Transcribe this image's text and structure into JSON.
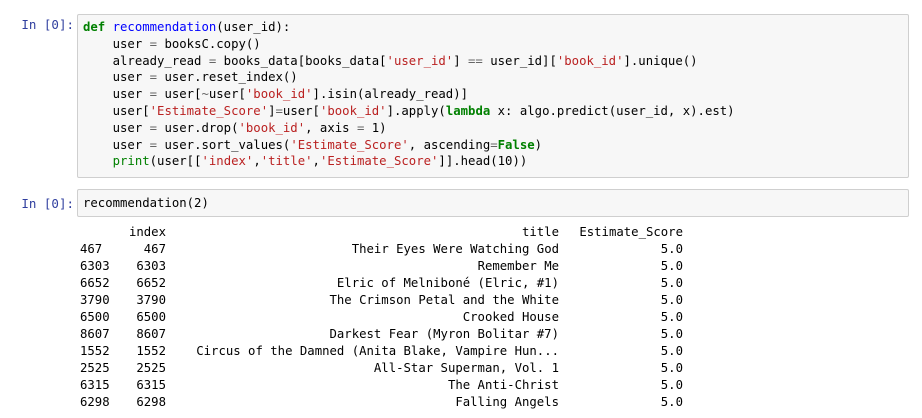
{
  "cells": [
    {
      "prompt": "In [0]:",
      "code_lines": [
        [
          {
            "t": "k",
            "v": "def"
          },
          {
            "t": "n",
            "v": " "
          },
          {
            "t": "f",
            "v": "recommendation"
          },
          {
            "t": "n",
            "v": "(user_id):"
          }
        ],
        [
          {
            "t": "n",
            "v": "    user "
          },
          {
            "t": "o",
            "v": "="
          },
          {
            "t": "n",
            "v": " booksC.copy()"
          }
        ],
        [
          {
            "t": "n",
            "v": "    already_read "
          },
          {
            "t": "o",
            "v": "="
          },
          {
            "t": "n",
            "v": " books_data[books_data["
          },
          {
            "t": "s",
            "v": "'user_id'"
          },
          {
            "t": "n",
            "v": "] "
          },
          {
            "t": "o",
            "v": "=="
          },
          {
            "t": "n",
            "v": " user_id]["
          },
          {
            "t": "s",
            "v": "'book_id'"
          },
          {
            "t": "n",
            "v": "].unique()"
          }
        ],
        [
          {
            "t": "n",
            "v": "    user "
          },
          {
            "t": "o",
            "v": "="
          },
          {
            "t": "n",
            "v": " user.reset_index()"
          }
        ],
        [
          {
            "t": "n",
            "v": "    user "
          },
          {
            "t": "o",
            "v": "="
          },
          {
            "t": "n",
            "v": " user["
          },
          {
            "t": "o",
            "v": "~"
          },
          {
            "t": "n",
            "v": "user["
          },
          {
            "t": "s",
            "v": "'book_id'"
          },
          {
            "t": "n",
            "v": "].isin(already_read)]"
          }
        ],
        [
          {
            "t": "n",
            "v": "    user["
          },
          {
            "t": "s",
            "v": "'Estimate_Score'"
          },
          {
            "t": "n",
            "v": "]"
          },
          {
            "t": "o",
            "v": "="
          },
          {
            "t": "n",
            "v": "user["
          },
          {
            "t": "s",
            "v": "'book_id'"
          },
          {
            "t": "n",
            "v": "].apply("
          },
          {
            "t": "k",
            "v": "lambda"
          },
          {
            "t": "n",
            "v": " x: algo.predict(user_id, x).est)"
          }
        ],
        [
          {
            "t": "n",
            "v": "    user "
          },
          {
            "t": "o",
            "v": "="
          },
          {
            "t": "n",
            "v": " user.drop("
          },
          {
            "t": "s",
            "v": "'book_id'"
          },
          {
            "t": "n",
            "v": ", axis "
          },
          {
            "t": "o",
            "v": "="
          },
          {
            "t": "n",
            "v": " 1)"
          }
        ],
        [
          {
            "t": "n",
            "v": "    user "
          },
          {
            "t": "o",
            "v": "="
          },
          {
            "t": "n",
            "v": " user.sort_values("
          },
          {
            "t": "s",
            "v": "'Estimate_Score'"
          },
          {
            "t": "n",
            "v": ", ascending"
          },
          {
            "t": "o",
            "v": "="
          },
          {
            "t": "k",
            "v": "False"
          },
          {
            "t": "n",
            "v": ")"
          }
        ],
        [
          {
            "t": "n",
            "v": "    "
          },
          {
            "t": "b",
            "v": "print"
          },
          {
            "t": "n",
            "v": "(user[["
          },
          {
            "t": "s",
            "v": "'index'"
          },
          {
            "t": "n",
            "v": ","
          },
          {
            "t": "s",
            "v": "'title'"
          },
          {
            "t": "n",
            "v": ","
          },
          {
            "t": "s",
            "v": "'Estimate_Score'"
          },
          {
            "t": "n",
            "v": "]].head(10))"
          }
        ]
      ]
    },
    {
      "prompt": "In [0]:",
      "code_lines": [
        [
          {
            "t": "n",
            "v": "recommendation(2)"
          }
        ]
      ]
    }
  ],
  "output": {
    "header": {
      "idx": "",
      "index": "index",
      "title": "title",
      "score": "Estimate_Score"
    },
    "rows": [
      {
        "idx": "467",
        "index": "467",
        "title": "Their Eyes Were Watching God",
        "score": "5.0"
      },
      {
        "idx": "6303",
        "index": "6303",
        "title": "Remember Me",
        "score": "5.0"
      },
      {
        "idx": "6652",
        "index": "6652",
        "title": "Elric of Melniboné (Elric, #1)",
        "score": "5.0"
      },
      {
        "idx": "3790",
        "index": "3790",
        "title": "The Crimson Petal and the White",
        "score": "5.0"
      },
      {
        "idx": "6500",
        "index": "6500",
        "title": "Crooked House",
        "score": "5.0"
      },
      {
        "idx": "8607",
        "index": "8607",
        "title": "Darkest Fear (Myron Bolitar #7)",
        "score": "5.0"
      },
      {
        "idx": "1552",
        "index": "1552",
        "title": "Circus of the Damned (Anita Blake, Vampire Hun...",
        "score": "5.0"
      },
      {
        "idx": "2525",
        "index": "2525",
        "title": "All-Star Superman, Vol. 1",
        "score": "5.0"
      },
      {
        "idx": "6315",
        "index": "6315",
        "title": "The Anti-Christ",
        "score": "5.0"
      },
      {
        "idx": "6298",
        "index": "6298",
        "title": "Falling Angels",
        "score": "5.0"
      }
    ]
  }
}
